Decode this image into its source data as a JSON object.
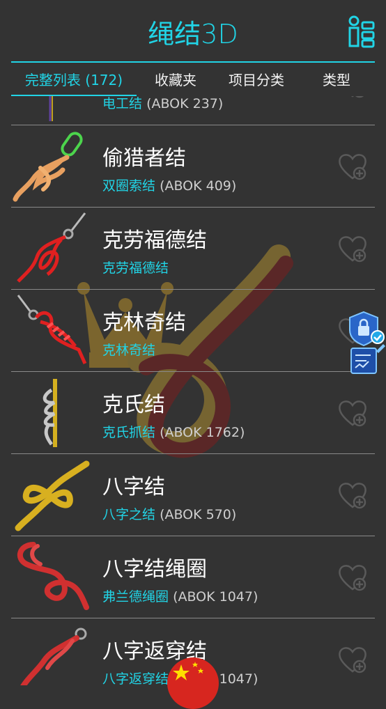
{
  "app": {
    "title_main": "绳结",
    "title_suffix": "3D"
  },
  "tabs": [
    {
      "label": "完整列表 (172)"
    },
    {
      "label": "收藏夹"
    },
    {
      "label": "项目分类"
    },
    {
      "label": "类型"
    }
  ],
  "partial_item": {
    "alt_name": "电工结",
    "abok": "(ABOK 237)"
  },
  "items": [
    {
      "name": "偷猎者结",
      "alt_name": "双圈索结",
      "abok": "(ABOK 409)",
      "rope_color": "#e8a060",
      "thumb_icon": "poachers-knot-icon"
    },
    {
      "name": "克劳福德结",
      "alt_name": "克劳福德结",
      "abok": "",
      "rope_color": "#e02020",
      "thumb_icon": "crawford-knot-icon"
    },
    {
      "name": "克林奇结",
      "alt_name": "克林奇结",
      "abok": "",
      "rope_color": "#e02020",
      "thumb_icon": "clinch-knot-icon"
    },
    {
      "name": "克氏结",
      "alt_name": "克氏抓结",
      "abok": "(ABOK 1762)",
      "rope_color": "#c8c8c8",
      "thumb_icon": "klemheist-knot-icon"
    },
    {
      "name": "八字结",
      "alt_name": "八字之结",
      "abok": "(ABOK 570)",
      "rope_color": "#d8b020",
      "thumb_icon": "figure-eight-knot-icon"
    },
    {
      "name": "八字结绳圈",
      "alt_name": "弗兰德绳圈",
      "abok": "(ABOK 1047)",
      "rope_color": "#d03030",
      "thumb_icon": "figure-eight-loop-icon"
    },
    {
      "name": "八字返穿结",
      "alt_name": "八字返穿结",
      "abok": "(ABOK 1047)",
      "rope_color": "#d03030",
      "thumb_icon": "figure-eight-follow-through-icon"
    }
  ],
  "colors": {
    "accent": "#21d4e6",
    "background": "#333333",
    "separator": "#8a8a8a",
    "heart": "#5a5a5a"
  }
}
